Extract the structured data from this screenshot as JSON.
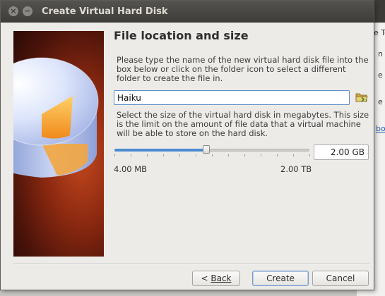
{
  "window": {
    "title": "Create Virtual Hard Disk"
  },
  "background_app": {
    "fragments": [
      "e Te",
      "n",
      "e",
      "e",
      "bo"
    ]
  },
  "page": {
    "heading": "File location and size",
    "location_instructions": "Please type the name of the new virtual hard disk file into the box below or click on the folder icon to select a different folder to create the file in.",
    "file_name": "Haiku",
    "size_instructions": "Select the size of the virtual hard disk in megabytes. This size is the limit on the amount of file data that a virtual machine will be able to store on the hard disk.",
    "size_slider": {
      "min_label": "4.00 MB",
      "max_label": "2.00 TB",
      "position_fraction": 0.47
    },
    "size_value": "2.00 GB"
  },
  "buttons": {
    "back_arrow": "<",
    "back": "Back",
    "create": "Create",
    "cancel": "Cancel"
  },
  "colors": {
    "accent": "#4a8ad0",
    "banner": "#8a2810",
    "titlebar": "#3d3c38"
  },
  "icons": [
    "close-icon",
    "minimize-icon",
    "folder-icon",
    "disk-illustration"
  ]
}
